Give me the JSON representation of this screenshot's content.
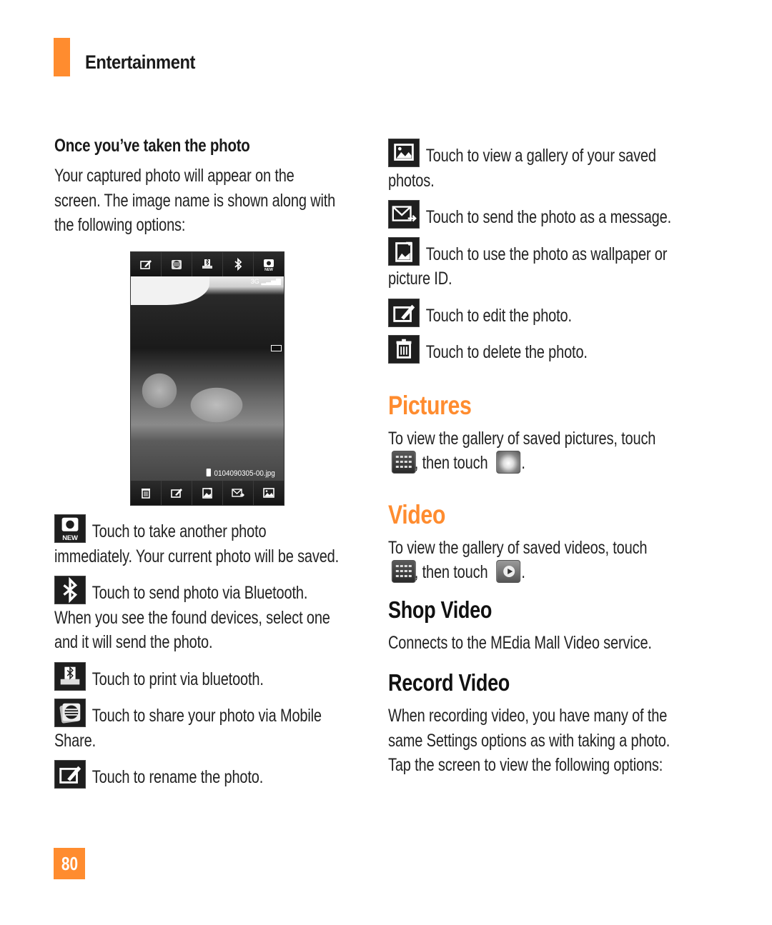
{
  "header": {
    "section_title": "Entertainment",
    "accent_color": "#ff8c2f"
  },
  "left": {
    "subhead": "Once you’ve taken the photo",
    "intro": [
      "Your captured photo will appear on the",
      "screen. The image name is shown along with",
      "the following options:"
    ],
    "phone_screen": {
      "top_buttons": [
        "rename-icon",
        "mobile-share-icon",
        "print-icon",
        "bluetooth-icon",
        "new-photo-icon"
      ],
      "bottom_buttons": [
        "delete-icon",
        "edit-icon",
        "wallpaper-icon",
        "send-message-icon",
        "gallery-icon"
      ],
      "status": "3G",
      "filename": "0104090305-00.jpg"
    },
    "options": [
      {
        "icon": "new-photo-icon",
        "icon_text": "NEW",
        "lines": [
          "Touch to take another photo",
          "immediately. Your current photo will be saved."
        ]
      },
      {
        "icon": "bluetooth-icon",
        "lines": [
          "Touch to send photo via Bluetooth.",
          "When you see the found devices, select one",
          "and it will send the photo."
        ]
      },
      {
        "icon": "print-icon",
        "lines": [
          "Touch to print via bluetooth."
        ]
      },
      {
        "icon": "mobile-share-icon",
        "lines": [
          "Touch to share your photo via Mobile",
          "Share."
        ]
      },
      {
        "icon": "rename-icon",
        "lines": [
          "Touch to rename the photo."
        ]
      }
    ]
  },
  "right": {
    "options": [
      {
        "icon": "gallery-icon",
        "lines": [
          "Touch to view a gallery of your saved",
          "photos."
        ]
      },
      {
        "icon": "send-message-icon",
        "lines": [
          "Touch to send the photo as a message."
        ]
      },
      {
        "icon": "wallpaper-icon",
        "lines": [
          "Touch to use the photo as wallpaper or",
          "picture ID."
        ]
      },
      {
        "icon": "edit-icon",
        "lines": [
          "Touch to edit the photo."
        ]
      },
      {
        "icon": "delete-icon",
        "lines": [
          "Touch to delete the photo."
        ]
      }
    ],
    "pictures": {
      "heading": "Pictures",
      "line1": "To view the gallery of saved pictures, touch",
      "then": ", then touch",
      "end": "."
    },
    "video": {
      "heading": "Video",
      "line1": "To view the gallery of saved videos, touch",
      "then": ", then touch",
      "end": "."
    },
    "shop_video": {
      "heading": "Shop Video",
      "text": "Connects to the MEdia Mall Video service."
    },
    "record_video": {
      "heading": "Record Video",
      "lines": [
        "When recording video, you have many of the",
        "same Settings options as with taking a photo.",
        "Tap the screen to view the following options:"
      ]
    }
  },
  "footer": {
    "page_number": "80"
  }
}
